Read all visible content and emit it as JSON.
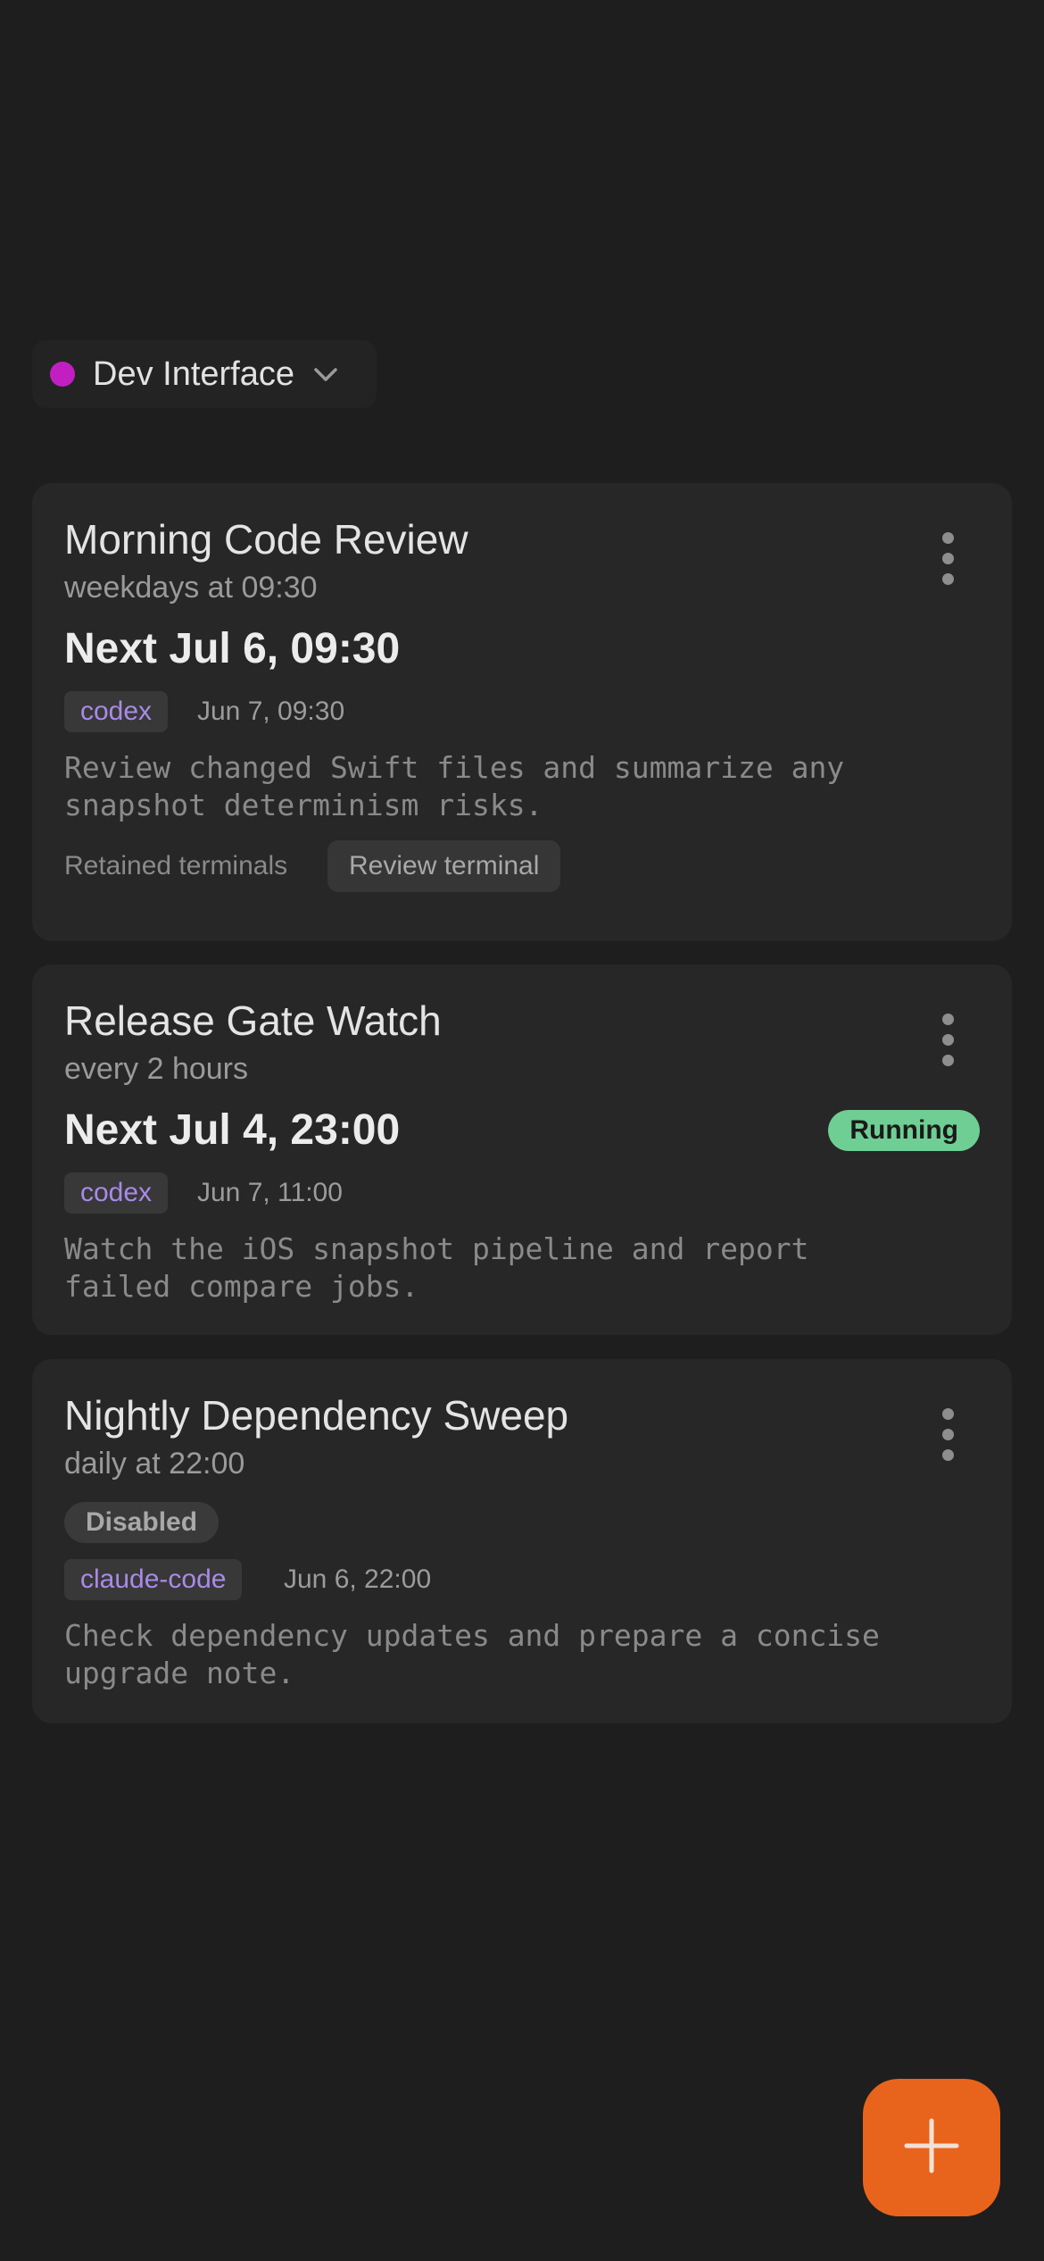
{
  "workspace": {
    "label": "Dev Interface",
    "dot_color": "#c21fc2",
    "icon": "chevron-down-icon"
  },
  "colors": {
    "accent": "#e8641c",
    "running": "#6fce93",
    "chip_text": "#a98ae8"
  },
  "tasks": [
    {
      "title": "Morning Code Review",
      "schedule": "weekdays at 09:30",
      "next": "Next Jul 6, 09:30",
      "agent": "codex",
      "last_run": "Jun 7, 09:30",
      "description": "Review changed Swift files and summarize any\nsnapshot determinism risks.",
      "retained_label": "Retained terminals",
      "terminal_button": "Review terminal"
    },
    {
      "title": "Release Gate Watch",
      "schedule": "every 2 hours",
      "next": "Next Jul 4, 23:00",
      "status": "Running",
      "agent": "codex",
      "last_run": "Jun 7, 11:00",
      "description": "Watch the iOS snapshot pipeline and report\nfailed compare jobs."
    },
    {
      "title": "Nightly Dependency Sweep",
      "schedule": "daily at 22:00",
      "status": "Disabled",
      "agent": "claude-code",
      "last_run": "Jun 6, 22:00",
      "description": "Check dependency updates and prepare a concise\nupgrade note."
    }
  ],
  "fab": {
    "icon": "plus-icon"
  }
}
